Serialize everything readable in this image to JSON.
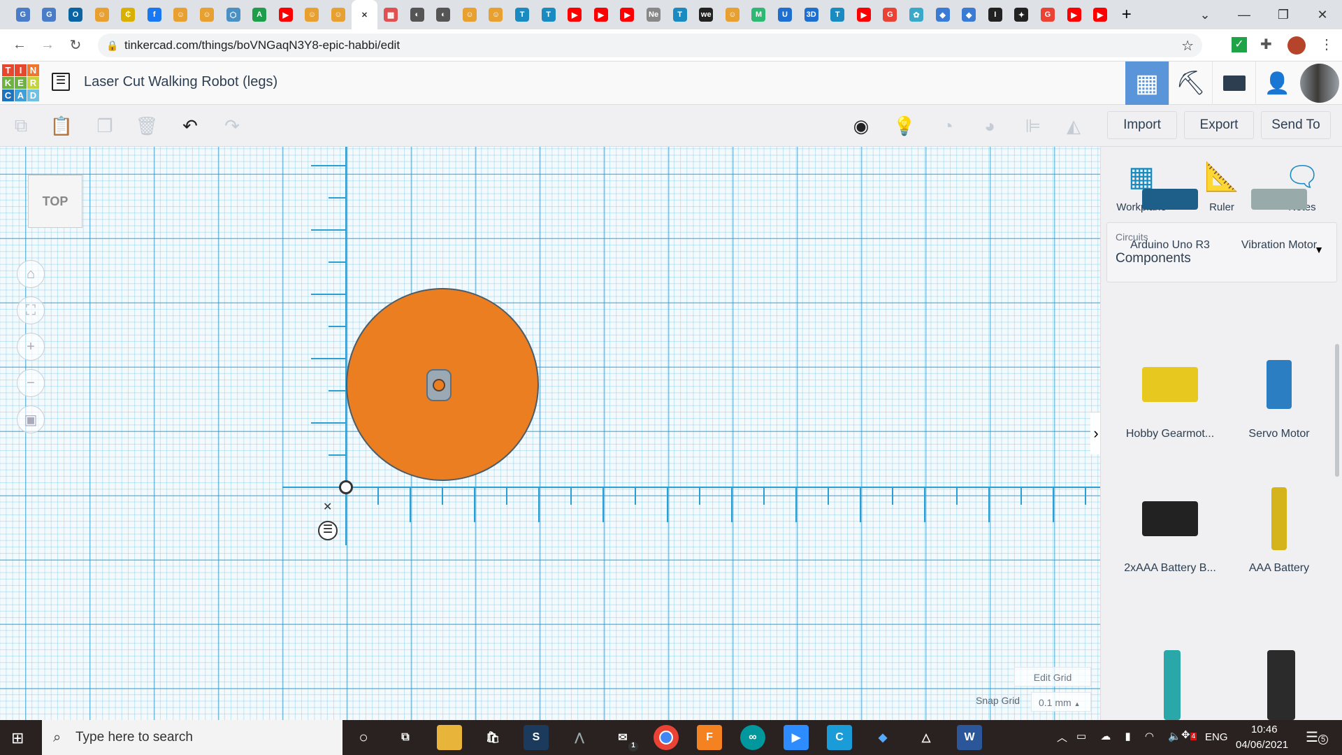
{
  "browser": {
    "tabs": [
      {
        "g": "G",
        "c": "#4a7cc7"
      },
      {
        "g": "G",
        "c": "#4a7cc7"
      },
      {
        "g": "O",
        "c": "#0a64a4"
      },
      {
        "g": "☺",
        "c": "#e8a030"
      },
      {
        "g": "₵",
        "c": "#d9b000"
      },
      {
        "g": "f",
        "c": "#1877f2"
      },
      {
        "g": "☺",
        "c": "#e8a030"
      },
      {
        "g": "☺",
        "c": "#e8a030"
      },
      {
        "g": "⬡",
        "c": "#4a90c2"
      },
      {
        "g": "A",
        "c": "#1e9e4a"
      },
      {
        "g": "▶",
        "c": "#ff0000"
      },
      {
        "g": "☺",
        "c": "#e8a030"
      },
      {
        "g": "☺",
        "c": "#e8a030"
      },
      {
        "g": "✕",
        "c": "#ffffff",
        "active": true
      },
      {
        "g": "▦",
        "c": "#e05050"
      },
      {
        "g": "◐",
        "c": "#555"
      },
      {
        "g": "◐",
        "c": "#555"
      },
      {
        "g": "☺",
        "c": "#e8a030"
      },
      {
        "g": "☺",
        "c": "#e8a030"
      },
      {
        "g": "T",
        "c": "#1a8bc0"
      },
      {
        "g": "T",
        "c": "#1a8bc0"
      },
      {
        "g": "▶",
        "c": "#ff0000"
      },
      {
        "g": "▶",
        "c": "#ff0000"
      },
      {
        "g": "▶",
        "c": "#ff0000"
      },
      {
        "g": "Ne",
        "c": "#888"
      },
      {
        "g": "T",
        "c": "#1a8bc0"
      },
      {
        "g": "we",
        "c": "#222"
      },
      {
        "g": "☺",
        "c": "#e8a030"
      },
      {
        "g": "M",
        "c": "#2eb872"
      },
      {
        "g": "U",
        "c": "#1f6fd1"
      },
      {
        "g": "3D",
        "c": "#1f6fd1"
      },
      {
        "g": "T",
        "c": "#1a8bc0"
      },
      {
        "g": "▶",
        "c": "#ff0000"
      },
      {
        "g": "G",
        "c": "#ea4335"
      },
      {
        "g": "✿",
        "c": "#3aa8c8"
      },
      {
        "g": "◆",
        "c": "#3a7bd5"
      },
      {
        "g": "◆",
        "c": "#3a7bd5"
      },
      {
        "g": "I",
        "c": "#222"
      },
      {
        "g": "✦",
        "c": "#222"
      },
      {
        "g": "G",
        "c": "#ea4335"
      },
      {
        "g": "▶",
        "c": "#ff0000"
      },
      {
        "g": "▶",
        "c": "#ff0000"
      }
    ],
    "new_tab": "+",
    "url": "tinkercad.com/things/boVNGaqN3Y8-epic-habbi/edit"
  },
  "app": {
    "logo": [
      "T",
      "I",
      "N",
      "K",
      "E",
      "R",
      "C",
      "A",
      "D"
    ],
    "logo_colors": [
      "#e8472d",
      "#e8472d",
      "#f0762c",
      "#6cb33f",
      "#6cb33f",
      "#c4d43a",
      "#1e73be",
      "#3fa1dc",
      "#6ec1e4"
    ],
    "title": "Laser Cut Walking Robot (legs)",
    "toolbar": {
      "import": "Import",
      "export": "Export",
      "send_to": "Send To"
    },
    "view_cube": "TOP",
    "tools": [
      {
        "label": "Workplane",
        "icon": "workplane-icon"
      },
      {
        "label": "Ruler",
        "icon": "ruler-icon"
      },
      {
        "label": "Notes",
        "icon": "notes-icon"
      }
    ],
    "library": {
      "category": "Circuits",
      "selected": "Components"
    },
    "components": [
      {
        "label": "Arduino Uno R3"
      },
      {
        "label": "Vibration Motor"
      },
      {
        "label": "Hobby Gearmot..."
      },
      {
        "label": "Servo Motor"
      },
      {
        "label": "2xAAA Battery B..."
      },
      {
        "label": "AAA Battery"
      }
    ],
    "edit_grid": "Edit Grid",
    "snap_grid_label": "Snap Grid",
    "snap_grid_value": "0.1 mm",
    "accent": "#5b95d9",
    "shape_color": "#eb7e21"
  },
  "taskbar": {
    "search_placeholder": "Type here to search",
    "mail_badge": "1",
    "lang": "ENG",
    "dropbox_badge": "4",
    "time": "10:46",
    "date": "04/06/2021",
    "notifications": "5"
  }
}
